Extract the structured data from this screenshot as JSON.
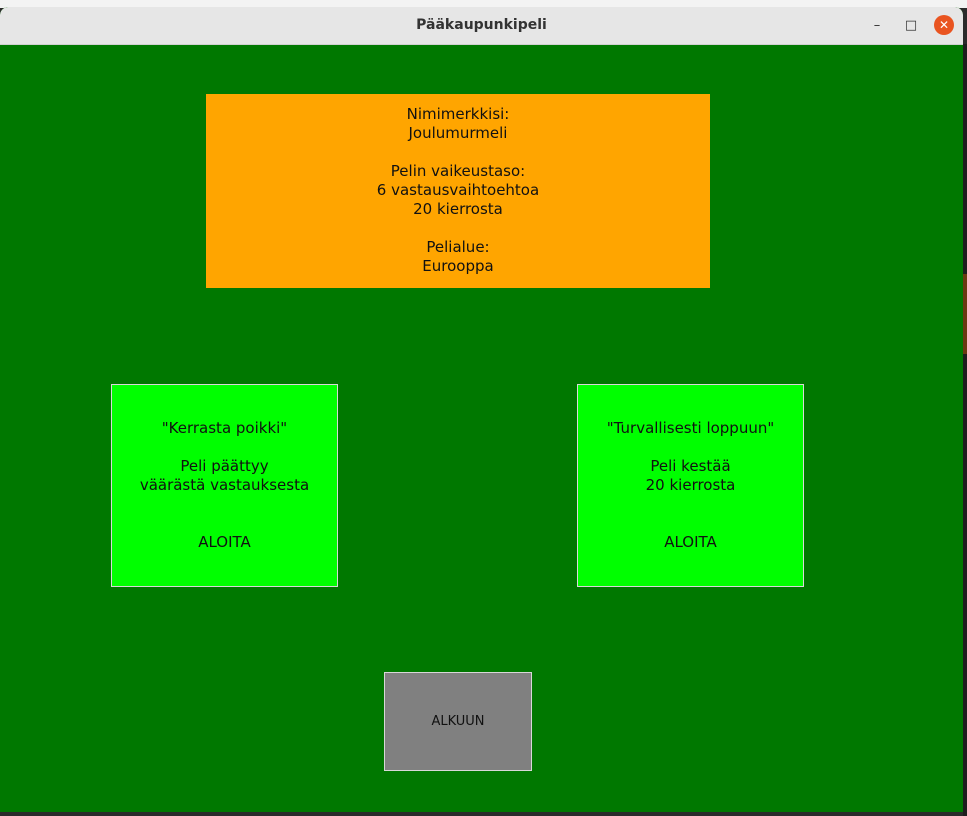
{
  "window": {
    "title": "Pääkaupunkipeli",
    "controls": {
      "minimize": "–",
      "maximize": "□",
      "close": "✕"
    },
    "colors": {
      "background": "#007800",
      "info_box": "#ffa500",
      "mode_box": "#00ff00",
      "home_button": "#808080",
      "close_button": "#e95420"
    }
  },
  "info": {
    "nickname_label": "Nimimerkkisi:",
    "nickname": "Joulumurmeli",
    "difficulty_label": "Pelin vaikeustaso:",
    "options": "6 vastausvaihtoehtoa",
    "rounds": "20 kierrosta",
    "area_label": "Pelialue:",
    "area": "Eurooppa"
  },
  "modes": [
    {
      "name": "\"Kerrasta poikki\"",
      "desc_line1": "Peli päättyy",
      "desc_line2": "väärästä vastauksesta",
      "action": "ALOITA"
    },
    {
      "name": "\"Turvallisesti loppuun\"",
      "desc_line1": "Peli kestää",
      "desc_line2": "20 kierrosta",
      "action": "ALOITA"
    }
  ],
  "home_button": {
    "label": "ALKUUN"
  }
}
